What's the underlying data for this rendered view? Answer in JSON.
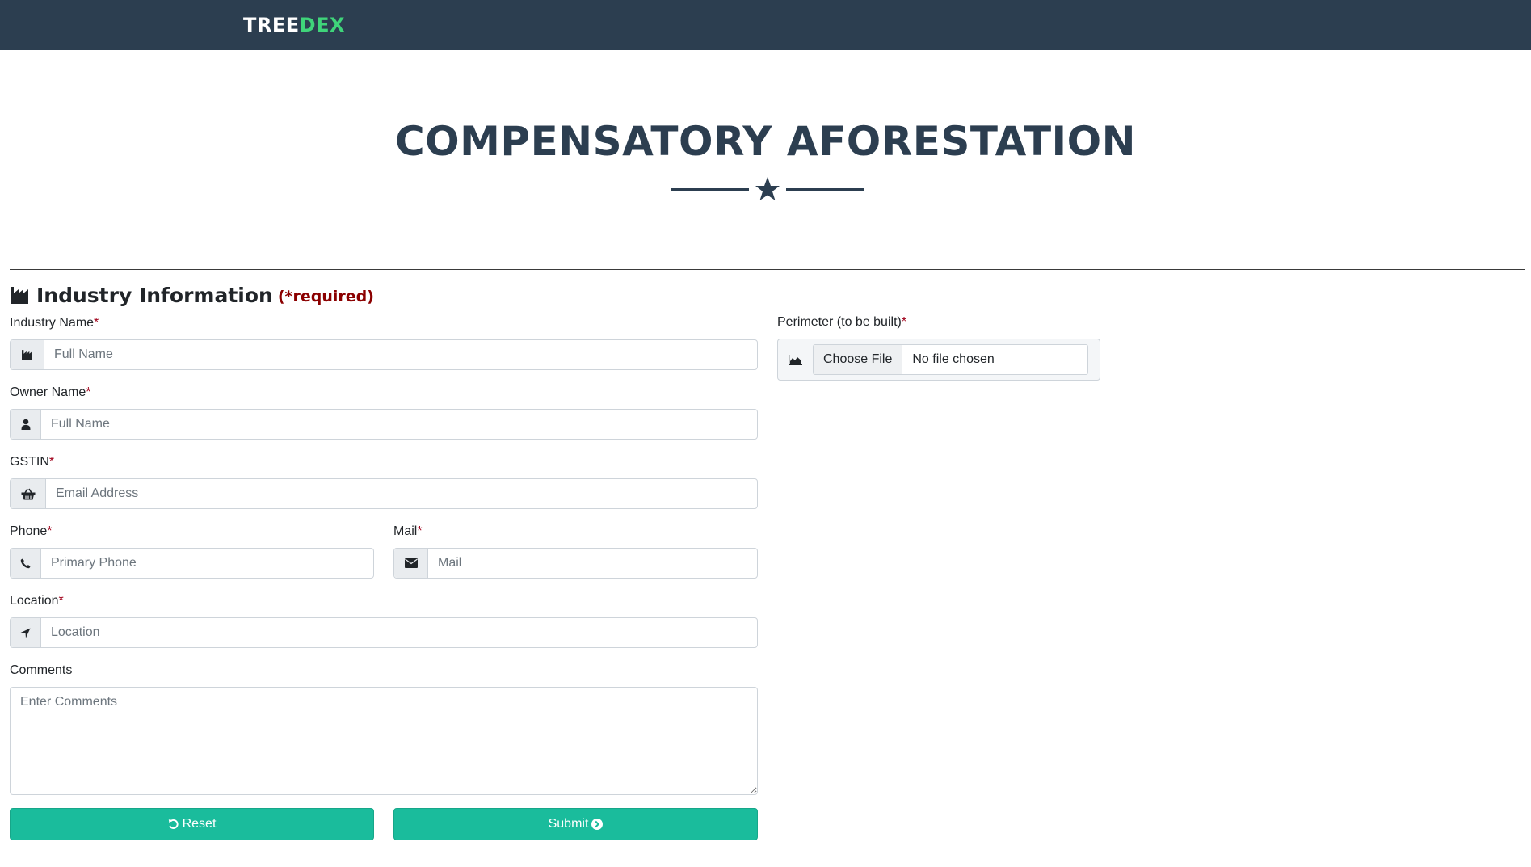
{
  "brand": {
    "part1": "TREE",
    "part2": "DEX"
  },
  "page": {
    "title": "COMPENSATORY AFORESTATION"
  },
  "section": {
    "title": "Industry Information",
    "required_note": "(*required)"
  },
  "fields": {
    "industry_name": {
      "label": "Industry Name",
      "required_mark": "*",
      "placeholder": "Full Name",
      "icon": "industry-icon"
    },
    "owner_name": {
      "label": "Owner Name",
      "required_mark": "*",
      "placeholder": "Full Name",
      "icon": "user-icon"
    },
    "gstin": {
      "label": "GSTIN",
      "required_mark": "*",
      "placeholder": "Email Address",
      "icon": "basket-icon"
    },
    "phone": {
      "label": "Phone",
      "required_mark": "*",
      "placeholder": "Primary Phone",
      "icon": "phone-icon"
    },
    "mail": {
      "label": "Mail",
      "required_mark": "*",
      "placeholder": "Mail",
      "icon": "envelope-icon"
    },
    "location": {
      "label": "Location",
      "required_mark": "*",
      "placeholder": "Location",
      "icon": "location-arrow-icon"
    },
    "comments": {
      "label": "Comments",
      "placeholder": "Enter Comments"
    },
    "perimeter": {
      "label": "Perimeter (to be built)",
      "required_mark": "*",
      "button": "Choose File",
      "status": "No file chosen",
      "icon": "area-chart-icon"
    }
  },
  "buttons": {
    "reset": "Reset",
    "submit": "Submit"
  },
  "colors": {
    "navbar": "#2c3e50",
    "brand_accent": "#3fd47a",
    "button": "#1abc9c",
    "required": "#8b0000"
  }
}
